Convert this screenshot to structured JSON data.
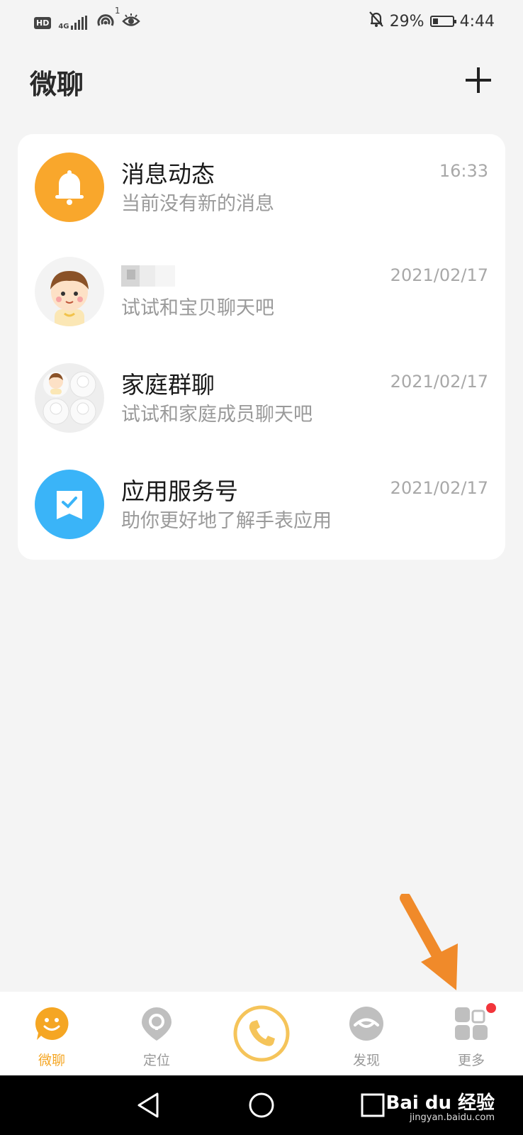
{
  "status_bar": {
    "hd": "HD",
    "network": "4G",
    "signal_superscript": "1",
    "battery_percent": "29%",
    "battery_level": 0.29,
    "time": "4:44",
    "icons": [
      "hd-icon",
      "signal-icon",
      "hotspot-icon",
      "eye-icon",
      "mute-bell-icon",
      "battery-icon"
    ]
  },
  "header": {
    "title": "微聊",
    "add_icon": "plus-icon"
  },
  "conversations": [
    {
      "title": "消息动态",
      "subtitle": "当前没有新的消息",
      "time": "16:33",
      "icon": "bell-icon",
      "avatar_color": "#f9a72c"
    },
    {
      "title": "",
      "subtitle": "试试和宝贝聊天吧",
      "time": "2021/02/17",
      "icon": "child-avatar",
      "avatar_color": "#f3f3f3"
    },
    {
      "title": "家庭群聊",
      "subtitle": "试试和家庭成员聊天吧",
      "time": "2021/02/17",
      "icon": "group-avatar",
      "avatar_color": "#eeeeee"
    },
    {
      "title": "应用服务号",
      "subtitle": "助你更好地了解手表应用",
      "time": "2021/02/17",
      "icon": "service-icon",
      "avatar_color": "#3ab4f8"
    }
  ],
  "tabs": [
    {
      "label": "微聊",
      "icon": "smile-chat-icon",
      "active": true,
      "color": "#f5a623"
    },
    {
      "label": "定位",
      "icon": "location-pin-icon",
      "active": false,
      "color": "#bfbfbf"
    },
    {
      "label": "",
      "icon": "phone-icon",
      "active": false,
      "color": "#f5c45a"
    },
    {
      "label": "发现",
      "icon": "eye-discover-icon",
      "active": false,
      "color": "#bfbfbf"
    },
    {
      "label": "更多",
      "icon": "grid-more-icon",
      "active": false,
      "color": "#bfbfbf",
      "badge_color": "#f2353b"
    }
  ],
  "navbar": {
    "icons": [
      "back-triangle-icon",
      "home-circle-icon",
      "recents-square-icon"
    ],
    "watermark": "Bai du 经验",
    "watermark_sub": "jingyan.baidu.com"
  },
  "annotation": {
    "icon": "orange-arrow",
    "color": "#f08a2a"
  }
}
